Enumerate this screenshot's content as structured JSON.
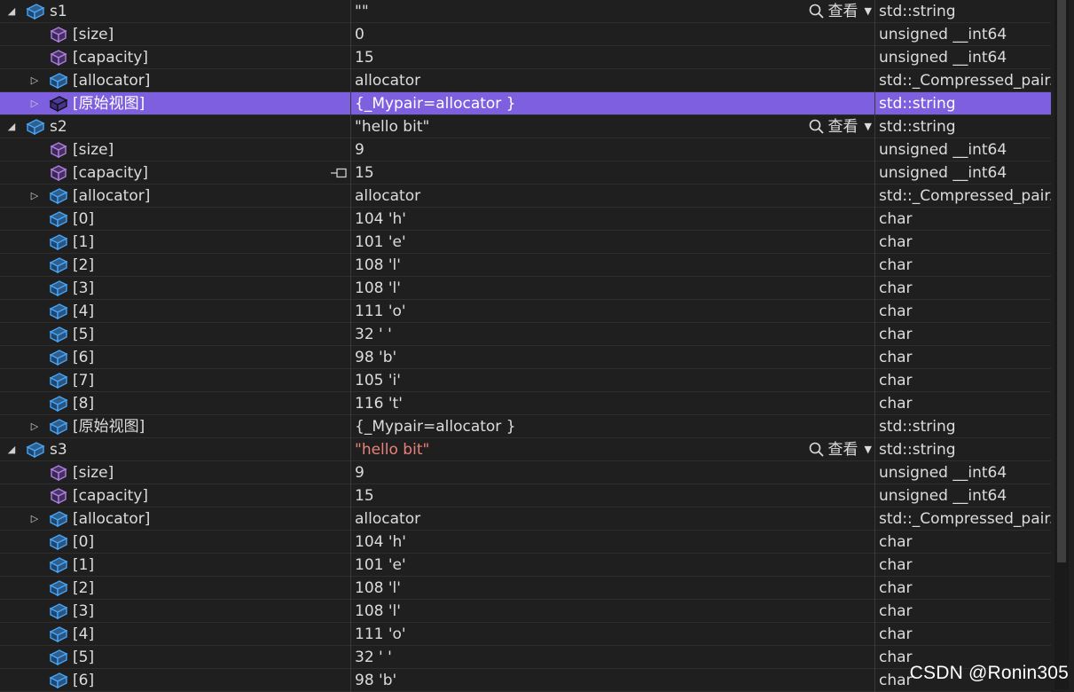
{
  "rows": [
    {
      "name": "s1",
      "value": "\"\"",
      "type": "std::string",
      "level": 0,
      "expander": "expanded",
      "icon": "blue",
      "view": true
    },
    {
      "name": "[size]",
      "value": "0",
      "type": "unsigned __int64",
      "level": 1,
      "expander": "none",
      "icon": "purple"
    },
    {
      "name": "[capacity]",
      "value": "15",
      "type": "unsigned __int64",
      "level": 1,
      "expander": "none",
      "icon": "purple"
    },
    {
      "name": "[allocator]",
      "value": "allocator",
      "type": "std::_Compressed_pair...",
      "level": 1,
      "expander": "collapsed",
      "icon": "blue"
    },
    {
      "name": "[原始视图]",
      "value": "{_Mypair=allocator }",
      "type": "std::string",
      "level": 1,
      "expander": "collapsed",
      "icon": "blue",
      "selected": true
    },
    {
      "name": "s2",
      "value": "\"hello bit\"",
      "type": "std::string",
      "level": 0,
      "expander": "expanded",
      "icon": "blue",
      "view": true
    },
    {
      "name": "[size]",
      "value": "9",
      "type": "unsigned __int64",
      "level": 1,
      "expander": "none",
      "icon": "purple"
    },
    {
      "name": "[capacity]",
      "value": "15",
      "type": "unsigned __int64",
      "level": 1,
      "expander": "none",
      "icon": "purple",
      "pin": true
    },
    {
      "name": "[allocator]",
      "value": "allocator",
      "type": "std::_Compressed_pair...",
      "level": 1,
      "expander": "collapsed",
      "icon": "blue"
    },
    {
      "name": "[0]",
      "value": "104 'h'",
      "type": "char",
      "level": 1,
      "expander": "none",
      "icon": "blue"
    },
    {
      "name": "[1]",
      "value": "101 'e'",
      "type": "char",
      "level": 1,
      "expander": "none",
      "icon": "blue"
    },
    {
      "name": "[2]",
      "value": "108 'l'",
      "type": "char",
      "level": 1,
      "expander": "none",
      "icon": "blue"
    },
    {
      "name": "[3]",
      "value": "108 'l'",
      "type": "char",
      "level": 1,
      "expander": "none",
      "icon": "blue"
    },
    {
      "name": "[4]",
      "value": "111 'o'",
      "type": "char",
      "level": 1,
      "expander": "none",
      "icon": "blue"
    },
    {
      "name": "[5]",
      "value": "32 ' '",
      "type": "char",
      "level": 1,
      "expander": "none",
      "icon": "blue"
    },
    {
      "name": "[6]",
      "value": "98 'b'",
      "type": "char",
      "level": 1,
      "expander": "none",
      "icon": "blue"
    },
    {
      "name": "[7]",
      "value": "105 'i'",
      "type": "char",
      "level": 1,
      "expander": "none",
      "icon": "blue"
    },
    {
      "name": "[8]",
      "value": "116 't'",
      "type": "char",
      "level": 1,
      "expander": "none",
      "icon": "blue"
    },
    {
      "name": "[原始视图]",
      "value": "{_Mypair=allocator }",
      "type": "std::string",
      "level": 1,
      "expander": "collapsed",
      "icon": "blue"
    },
    {
      "name": "s3",
      "value": "\"hello bit\"",
      "type": "std::string",
      "level": 0,
      "expander": "expanded",
      "icon": "blue",
      "view": true,
      "changed": true
    },
    {
      "name": "[size]",
      "value": "9",
      "type": "unsigned __int64",
      "level": 1,
      "expander": "none",
      "icon": "purple"
    },
    {
      "name": "[capacity]",
      "value": "15",
      "type": "unsigned __int64",
      "level": 1,
      "expander": "none",
      "icon": "purple"
    },
    {
      "name": "[allocator]",
      "value": "allocator",
      "type": "std::_Compressed_pair...",
      "level": 1,
      "expander": "collapsed",
      "icon": "blue"
    },
    {
      "name": "[0]",
      "value": "104 'h'",
      "type": "char",
      "level": 1,
      "expander": "none",
      "icon": "blue"
    },
    {
      "name": "[1]",
      "value": "101 'e'",
      "type": "char",
      "level": 1,
      "expander": "none",
      "icon": "blue"
    },
    {
      "name": "[2]",
      "value": "108 'l'",
      "type": "char",
      "level": 1,
      "expander": "none",
      "icon": "blue"
    },
    {
      "name": "[3]",
      "value": "108 'l'",
      "type": "char",
      "level": 1,
      "expander": "none",
      "icon": "blue"
    },
    {
      "name": "[4]",
      "value": "111 'o'",
      "type": "char",
      "level": 1,
      "expander": "none",
      "icon": "blue"
    },
    {
      "name": "[5]",
      "value": "32 ' '",
      "type": "char",
      "level": 1,
      "expander": "none",
      "icon": "blue"
    },
    {
      "name": "[6]",
      "value": "98 'b'",
      "type": "char",
      "level": 1,
      "expander": "none",
      "icon": "blue"
    }
  ],
  "view_label": "查看",
  "watermark": "CSDN @Ronin305",
  "icon_names": {
    "blue": "object-cube-icon",
    "purple": "property-cube-icon",
    "pin": "pin-icon",
    "view": "magnifier-icon"
  },
  "colors": {
    "background": "#1f1f1f",
    "selected_row": "#7d5fe0",
    "changed_value": "#e8817c",
    "object_icon": "#4aa3f0",
    "property_icon": "#b07fe0"
  }
}
